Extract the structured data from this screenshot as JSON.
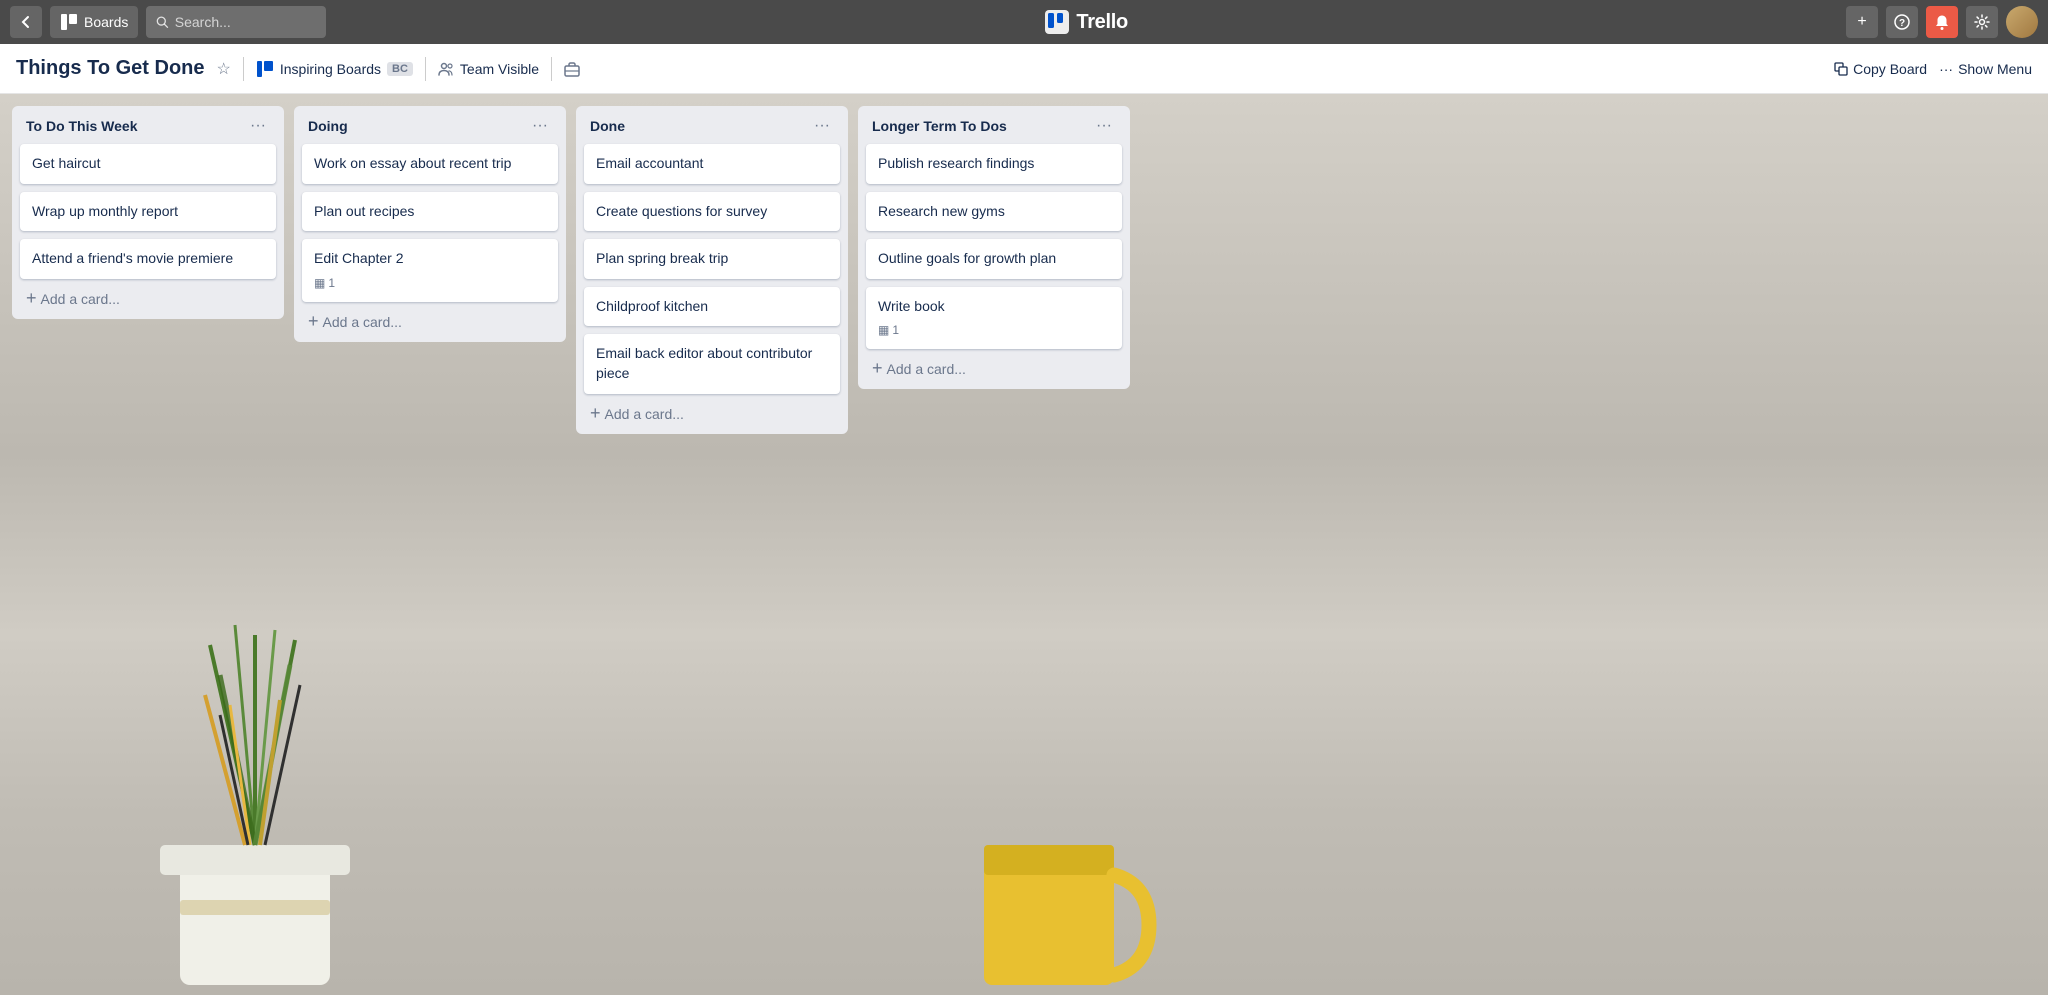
{
  "topnav": {
    "back_label": "←",
    "boards_label": "Boards",
    "search_placeholder": "Search...",
    "logo_text": "Trello",
    "add_label": "+",
    "info_label": "?",
    "notification_label": "🔔",
    "settings_label": "⚙"
  },
  "board_header": {
    "title": "Things To Get Done",
    "star_icon": "☆",
    "team_name": "Inspiring Boards",
    "team_badge": "BC",
    "visibility": "Team Visible",
    "briefcase_icon": "💼",
    "copy_board_label": "Copy Board",
    "show_menu_label": "Show Menu",
    "ellipsis": "···"
  },
  "lists": [
    {
      "id": "todo",
      "title": "To Do This Week",
      "cards": [
        {
          "text": "Get haircut",
          "badges": []
        },
        {
          "text": "Wrap up monthly report",
          "badges": []
        },
        {
          "text": "Attend a friend's movie premiere",
          "badges": []
        }
      ],
      "add_label": "Add a card..."
    },
    {
      "id": "doing",
      "title": "Doing",
      "cards": [
        {
          "text": "Work on essay about recent trip",
          "badges": []
        },
        {
          "text": "Plan out recipes",
          "badges": []
        },
        {
          "text": "Edit Chapter 2",
          "badges": [
            {
              "icon": "▦",
              "count": "1"
            }
          ]
        }
      ],
      "add_label": "Add a card..."
    },
    {
      "id": "done",
      "title": "Done",
      "cards": [
        {
          "text": "Email accountant",
          "badges": []
        },
        {
          "text": "Create questions for survey",
          "badges": []
        },
        {
          "text": "Plan spring break trip",
          "badges": []
        },
        {
          "text": "Childproof kitchen",
          "badges": []
        },
        {
          "text": "Email back editor about contributor piece",
          "badges": []
        }
      ],
      "add_label": "Add a card..."
    },
    {
      "id": "longer",
      "title": "Longer Term To Dos",
      "cards": [
        {
          "text": "Publish research findings",
          "badges": []
        },
        {
          "text": "Research new gyms",
          "badges": []
        },
        {
          "text": "Outline goals for growth plan",
          "badges": []
        },
        {
          "text": "Write book",
          "badges": [
            {
              "icon": "▦",
              "count": "1"
            }
          ]
        }
      ],
      "add_label": "Add a card..."
    }
  ]
}
